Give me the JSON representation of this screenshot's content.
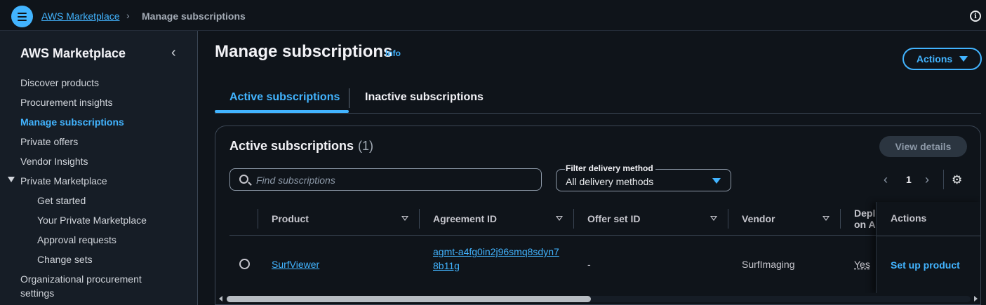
{
  "topbar": {
    "breadcrumb_root": "AWS Marketplace",
    "breadcrumb_separator": "›",
    "breadcrumb_current": "Manage subscriptions",
    "info_icon_glyph": "i"
  },
  "sidebar": {
    "title": "AWS Marketplace",
    "close_glyph": "‹",
    "items": [
      {
        "label": "Discover products"
      },
      {
        "label": "Procurement insights"
      },
      {
        "label": "Manage subscriptions"
      },
      {
        "label": "Private offers"
      },
      {
        "label": "Vendor Insights"
      },
      {
        "label": "Private Marketplace"
      },
      {
        "label": "Get started"
      },
      {
        "label": "Your Private Marketplace"
      },
      {
        "label": "Approval requests"
      },
      {
        "label": "Change sets"
      },
      {
        "label": "Organizational procurement"
      },
      {
        "label": "settings"
      }
    ]
  },
  "main": {
    "title": "Manage subscriptions",
    "info_link": "Info",
    "actions_button": "Actions",
    "tabs": [
      {
        "label": "Active subscriptions"
      },
      {
        "label": "Inactive subscriptions"
      }
    ],
    "container": {
      "title": "Active subscriptions",
      "count": "(1)",
      "view_details": "View details",
      "search_placeholder": "Find subscriptions",
      "filter_label": "Filter delivery method",
      "filter_value": "All delivery methods",
      "pager": {
        "prev": "‹",
        "current": "1",
        "next": "›"
      },
      "settings_glyph": "⚙",
      "columns": [
        "Product",
        "Agreement ID",
        "Offer set ID",
        "Vendor",
        "Depl on A",
        "Actions"
      ],
      "rows": [
        {
          "product": "SurfViewer",
          "agreement_id": "agmt-a4fg0in2j96smq8sdyn78b11g",
          "offer_set_id": "-",
          "vendor": "SurfImaging",
          "deployed": "Yes",
          "action": "Set up product"
        }
      ]
    }
  },
  "colors": {
    "background": "#0f141a",
    "sidebar_background": "#161d26",
    "accent": "#42b4ff",
    "text_primary": "#f3f3f7",
    "text_secondary": "#c6c6cd"
  }
}
